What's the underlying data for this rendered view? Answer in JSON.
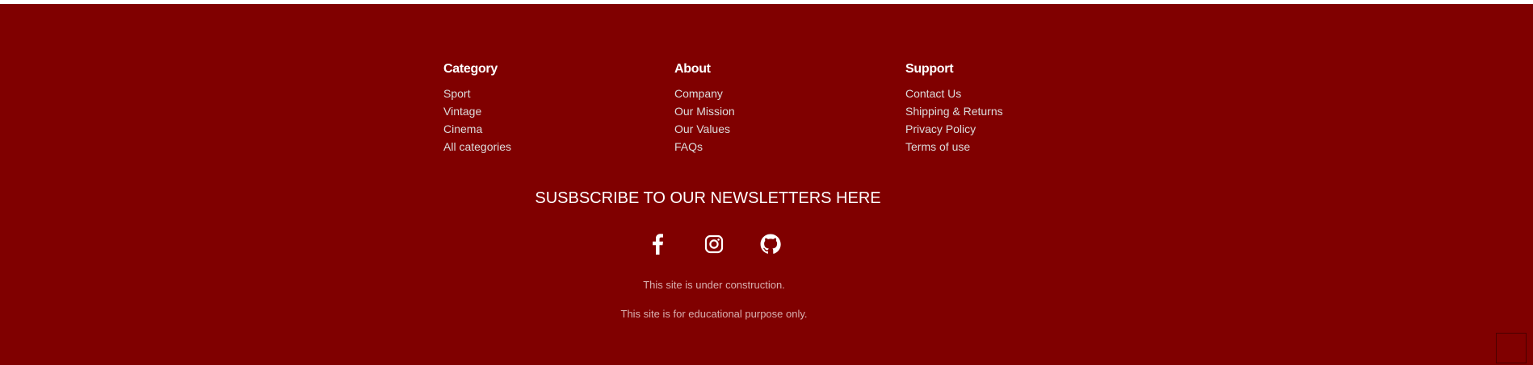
{
  "footer": {
    "columns": [
      {
        "title": "Category",
        "items": [
          "Sport",
          "Vintage",
          "Cinema",
          "All categories"
        ]
      },
      {
        "title": "About",
        "items": [
          "Company",
          "Our Mission",
          "Our Values",
          "FAQs"
        ]
      },
      {
        "title": "Support",
        "items": [
          "Contact Us",
          "Shipping & Returns",
          "Privacy Policy",
          "Terms of use"
        ]
      }
    ],
    "newsletter": "SUSBSCRIBE TO OUR NEWSLETTERS HERE",
    "socials": [
      "facebook-icon",
      "instagram-icon",
      "github-icon"
    ],
    "notes": [
      "This site is under construction.",
      "This site is for educational purpose only."
    ],
    "colors": {
      "background": "#800000",
      "heading": "#ffffff",
      "link": "#dcdcdc",
      "note": "#d8b0b0"
    }
  }
}
